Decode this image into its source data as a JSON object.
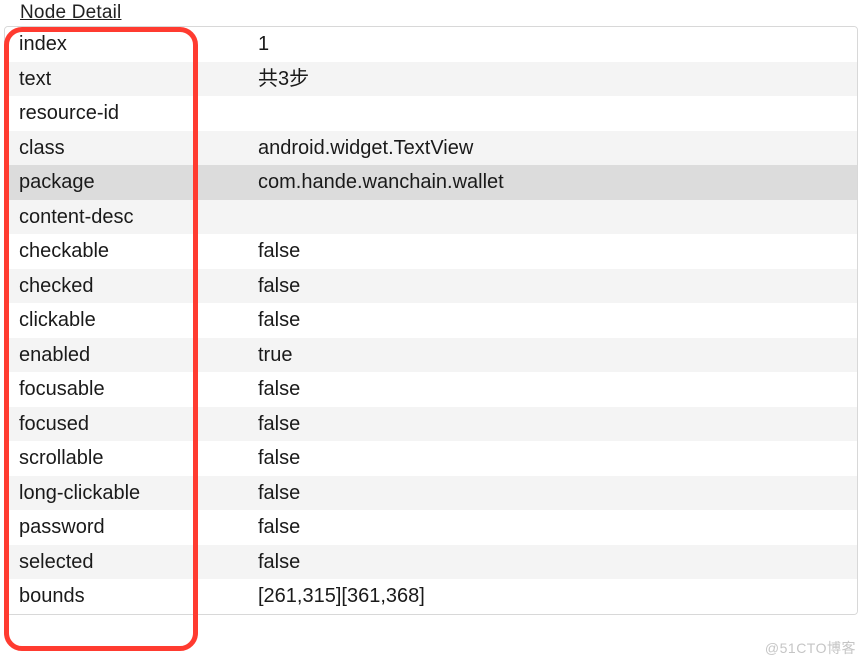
{
  "panel": {
    "title": "Node Detail"
  },
  "rows": [
    {
      "key": "index",
      "value": "1",
      "selected": false
    },
    {
      "key": "text",
      "value": "共3步",
      "selected": false
    },
    {
      "key": "resource-id",
      "value": "",
      "selected": false
    },
    {
      "key": "class",
      "value": "android.widget.TextView",
      "selected": false
    },
    {
      "key": "package",
      "value": "com.hande.wanchain.wallet",
      "selected": true
    },
    {
      "key": "content-desc",
      "value": "",
      "selected": false
    },
    {
      "key": "checkable",
      "value": "false",
      "selected": false
    },
    {
      "key": "checked",
      "value": "false",
      "selected": false
    },
    {
      "key": "clickable",
      "value": "false",
      "selected": false
    },
    {
      "key": "enabled",
      "value": "true",
      "selected": false
    },
    {
      "key": "focusable",
      "value": "false",
      "selected": false
    },
    {
      "key": "focused",
      "value": "false",
      "selected": false
    },
    {
      "key": "scrollable",
      "value": "false",
      "selected": false
    },
    {
      "key": "long-clickable",
      "value": "false",
      "selected": false
    },
    {
      "key": "password",
      "value": "false",
      "selected": false
    },
    {
      "key": "selected",
      "value": "false",
      "selected": false
    },
    {
      "key": "bounds",
      "value": "[261,315][361,368]",
      "selected": false
    }
  ],
  "watermark": "@51CTO博客",
  "annotation": {
    "color": "#ff3b30"
  }
}
